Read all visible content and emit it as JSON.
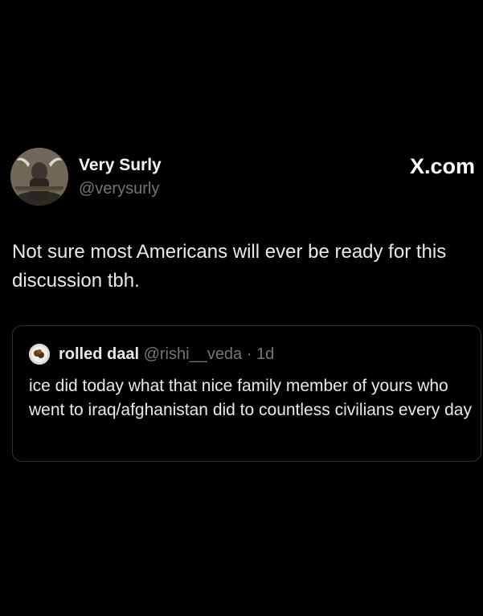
{
  "brand": {
    "label": "X.com"
  },
  "post": {
    "author_name": "Very Surly",
    "author_handle": "@verysurly",
    "text": "Not sure most Americans will ever be ready for this discussion tbh."
  },
  "quote": {
    "author_name": "rolled daal",
    "author_handle": "@rishi__veda",
    "separator": "·",
    "timestamp": "1d",
    "text": "ice did today what that nice family member of yours who went to iraq/afghanistan did to countless civilians every day"
  },
  "colors": {
    "background": "#000000",
    "primary_text": "#e7e9ea",
    "secondary_text": "#71767b",
    "card_border": "#2f3336"
  }
}
